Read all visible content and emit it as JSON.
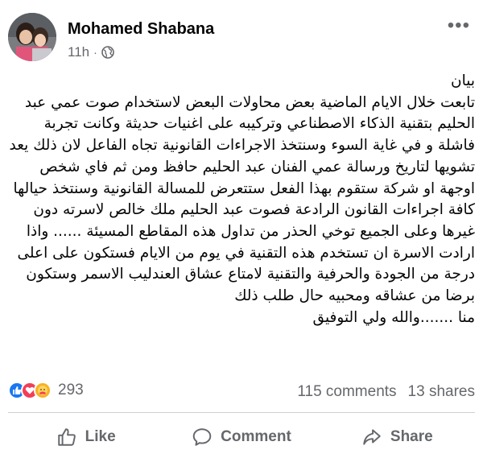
{
  "post": {
    "author": "Mohamed Shabana",
    "time": "11h",
    "separator": "·",
    "privacy_icon": "globe-icon",
    "more_icon": "more-dots-icon",
    "body": "بيان\nتابعت خلال الايام الماضية بعض محاولات البعض لاستخدام صوت عمي عبد الحليم بتقنية الذكاء الاصطناعي وتركيبه على اغنيات حديثة وكانت تجربة فاشلة و في غاية السوء وسنتخذ الاجراءات القانونية تجاه الفاعل لان ذلك يعد تشويها لتاريخ ورسالة عمي الفنان عبد الحليم حافظ ومن ثم فاي شخص اوجهة او شركة ستقوم بهذا الفعل ستتعرض للمسالة القانونية وسنتخذ حيالها كافة اجراءات القانون الرادعة فصوت عبد الحليم ملك خالص لاسرته دون غيرها وعلى الجميع توخي الحذر من تداول هذه المقاطع المسيئة ...... واذا ارادت الاسرة ان تستخدم هذه التقنية في يوم من الايام فستكون على اعلى درجة من الجودة والحرفية والتقنية لامتاع عشاق العندليب الاسمر وستكون برضا من عشاقه ومحبيه حال طلب ذلك\nمنا .......والله ولي التوفيق"
  },
  "stats": {
    "reactions": [
      "like",
      "love",
      "care"
    ],
    "reaction_count": "293",
    "comments": "115 comments",
    "shares": "13 shares"
  },
  "actions": {
    "like": "Like",
    "comment": "Comment",
    "share": "Share"
  },
  "colors": {
    "like_blue": "#1877f2",
    "love_red": "#f33e58",
    "care_yellow": "#f7b125",
    "secondary_text": "#65676b"
  }
}
